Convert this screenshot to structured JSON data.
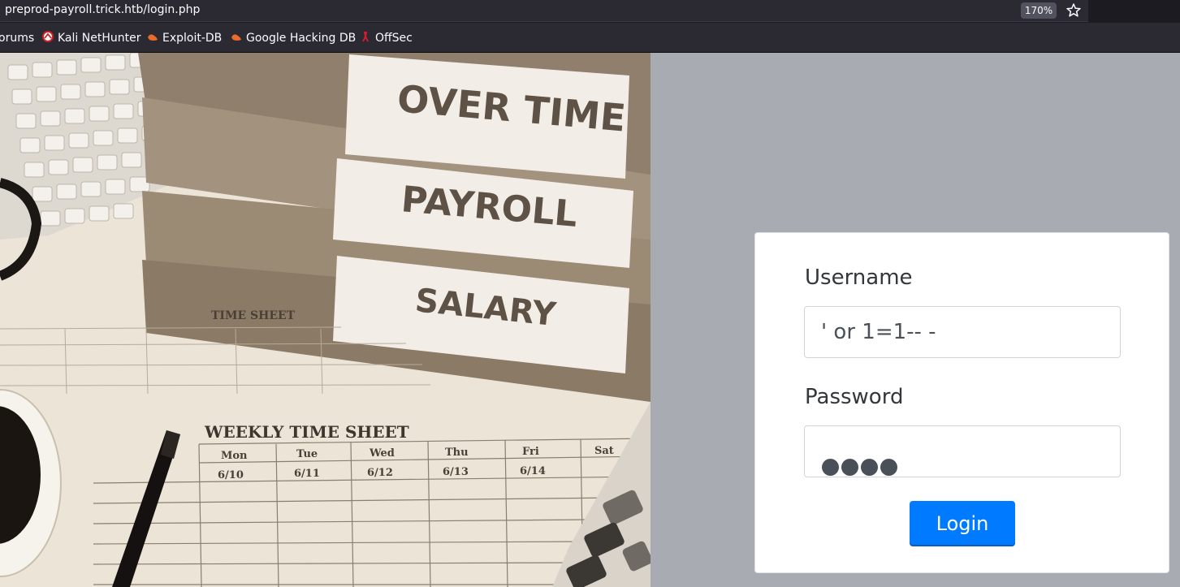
{
  "browser": {
    "url": "preprod-payroll.trick.htb/login.php",
    "zoom": "170%",
    "bookmarks": [
      {
        "label": "orums"
      },
      {
        "label": "Kali NetHunter",
        "icon": "kali-nethunter-icon"
      },
      {
        "label": "Exploit-DB",
        "icon": "exploit-db-icon"
      },
      {
        "label": "Google Hacking DB",
        "icon": "ghdb-icon"
      },
      {
        "label": "OffSec",
        "icon": "offsec-icon"
      }
    ]
  },
  "hero_image": {
    "binder_labels": [
      "OVER TIME",
      "PAYROLL",
      "SALARY"
    ],
    "sheet_titles": [
      "TIME SHEET",
      "WEEKLY TIME SHEET"
    ],
    "weekly_days": [
      "Mon",
      "Tue",
      "Wed",
      "Thu",
      "Fri",
      "Sat"
    ],
    "weekly_dates": [
      "6/10",
      "6/11",
      "6/12",
      "6/13",
      "6/14"
    ]
  },
  "login": {
    "username_label": "Username",
    "username_value": " ' or 1=1-- -",
    "password_label": "Password",
    "password_mask_count": 4,
    "login_button": "Login"
  },
  "colors": {
    "page_bg": "#a8abb1",
    "button": "#007bff",
    "photo_tone": "#e9e0d2"
  }
}
